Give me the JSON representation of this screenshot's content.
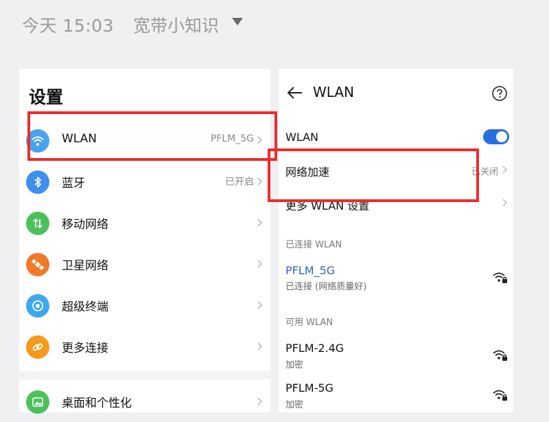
{
  "header": {
    "time": "今天 15:03",
    "channel": "宽带小知识"
  },
  "left": {
    "title": "设置",
    "items": [
      {
        "label": "WLAN",
        "value": "PFLM_5G",
        "icon": "wifi-icon",
        "color": "#4aa3f0"
      },
      {
        "label": "蓝牙",
        "value": "已开启",
        "icon": "bluetooth-icon",
        "color": "#3d8ff0"
      },
      {
        "label": "移动网络",
        "value": "",
        "icon": "mobile-data-icon",
        "color": "#4cc05a"
      },
      {
        "label": "卫星网络",
        "value": "",
        "icon": "satellite-icon",
        "color": "#f07a2a"
      },
      {
        "label": "超级终端",
        "value": "",
        "icon": "super-device-icon",
        "color": "#3da7f0"
      },
      {
        "label": "更多连接",
        "value": "",
        "icon": "link-icon",
        "color": "#f59a1a"
      },
      {
        "label": "桌面和个性化",
        "value": "",
        "icon": "wallpaper-icon",
        "color": "#4cc05a"
      }
    ]
  },
  "right": {
    "title": "WLAN",
    "toggle_label": "WLAN",
    "toggle_on": true,
    "accel_label": "网络加速",
    "accel_value": "已关闭",
    "more_label": "更多 WLAN 设置",
    "connected_header": "已连接 WLAN",
    "connected": {
      "name": "PFLM_5G",
      "sub": "已连接 (网络质量好)"
    },
    "available_header": "可用 WLAN",
    "available": [
      {
        "name": "PFLM-2.4G",
        "sub": "加密"
      },
      {
        "name": "PFLM-5G",
        "sub": "加密"
      }
    ]
  },
  "colors": {
    "accent": "#2a6fe0",
    "highlight": "#ee2b2b",
    "connected_name": "#2f63c4"
  }
}
